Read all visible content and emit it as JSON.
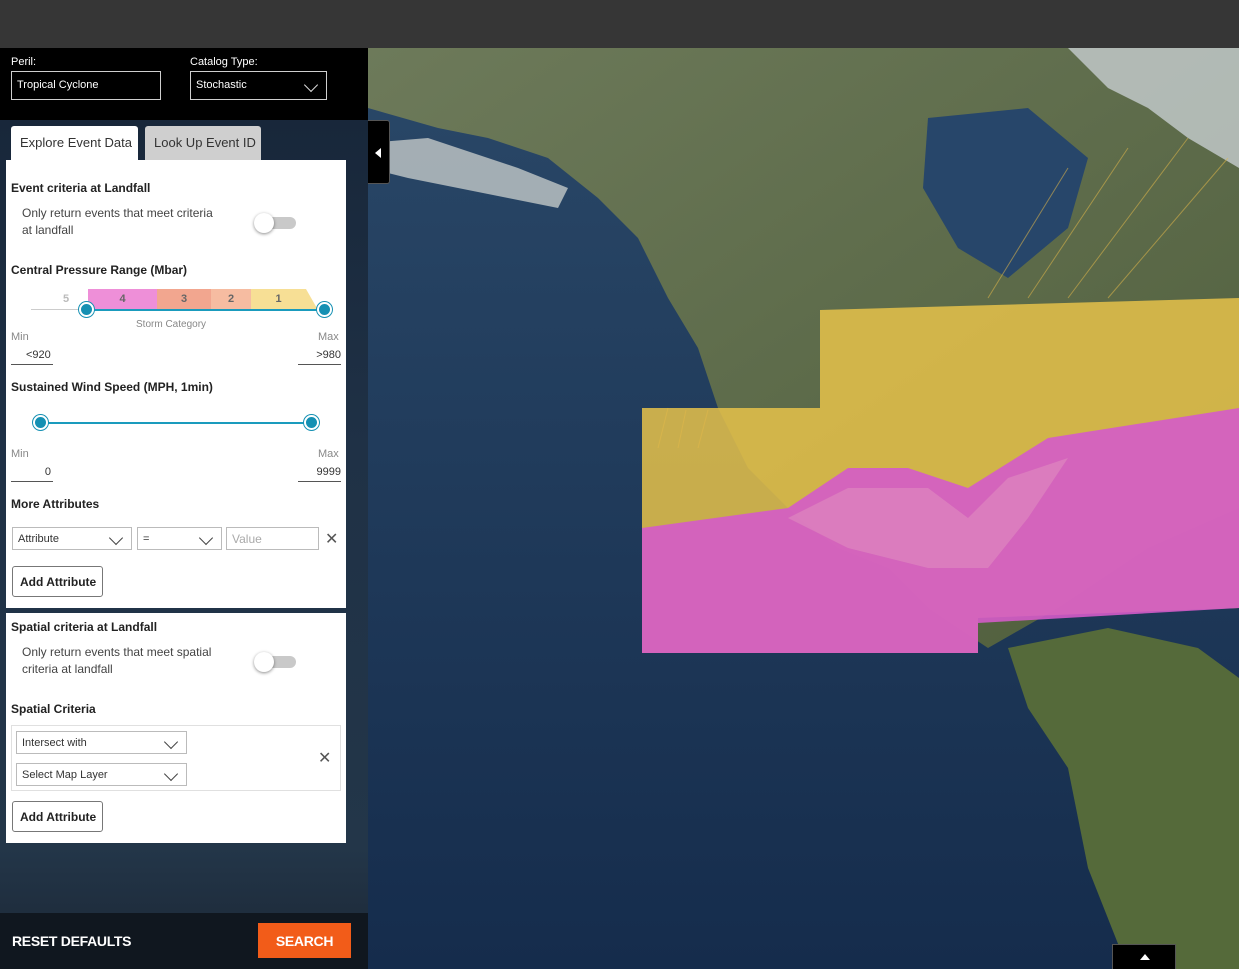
{
  "header": {
    "peril_label": "Peril:",
    "peril_value": "Tropical Cyclone",
    "catalog_label": "Catalog Type:",
    "catalog_value": "Stochastic"
  },
  "tabs": [
    {
      "label": "Explore Event Data",
      "active": true
    },
    {
      "label": "Look Up Event ID",
      "active": false
    }
  ],
  "event_criteria": {
    "title": "Event criteria at Landfall",
    "toggle_text_line1": "Only return events that meet criteria",
    "toggle_text_line2": "at landfall",
    "toggle_on": false
  },
  "central_pressure": {
    "title": "Central Pressure Range (Mbar)",
    "categories": [
      "5",
      "4",
      "3",
      "2",
      "1"
    ],
    "category_colors": [
      "#ffffff",
      "#ee8fd8",
      "#f2a68f",
      "#f6bca1",
      "#f7df95"
    ],
    "caption": "Storm Category",
    "min_label": "Min",
    "max_label": "Max",
    "min_value": "<920",
    "max_value": ">980"
  },
  "wind_speed": {
    "title": "Sustained Wind Speed (MPH, 1min)",
    "min_label": "Min",
    "max_label": "Max",
    "min_value": "0",
    "max_value": "9999"
  },
  "more_attributes": {
    "title": "More Attributes",
    "attribute_select": "Attribute",
    "operator_select": "=",
    "value_placeholder": "Value",
    "add_button": "Add Attribute"
  },
  "spatial": {
    "title": "Spatial criteria at Landfall",
    "toggle_text_line1": "Only return events that meet spatial",
    "toggle_text_line2": "criteria at landfall",
    "toggle_on": false,
    "criteria_title": "Spatial Criteria",
    "intersect_select": "Intersect with",
    "layer_select": "Select Map Layer",
    "add_button": "Add Attribute"
  },
  "footer": {
    "reset_label": "RESET DEFAULTS",
    "search_label": "SEARCH"
  },
  "colors": {
    "accent": "#f25c19",
    "slider": "#1590b3",
    "hazard_high": "#d45bc9",
    "hazard_low": "#e6c24a"
  }
}
